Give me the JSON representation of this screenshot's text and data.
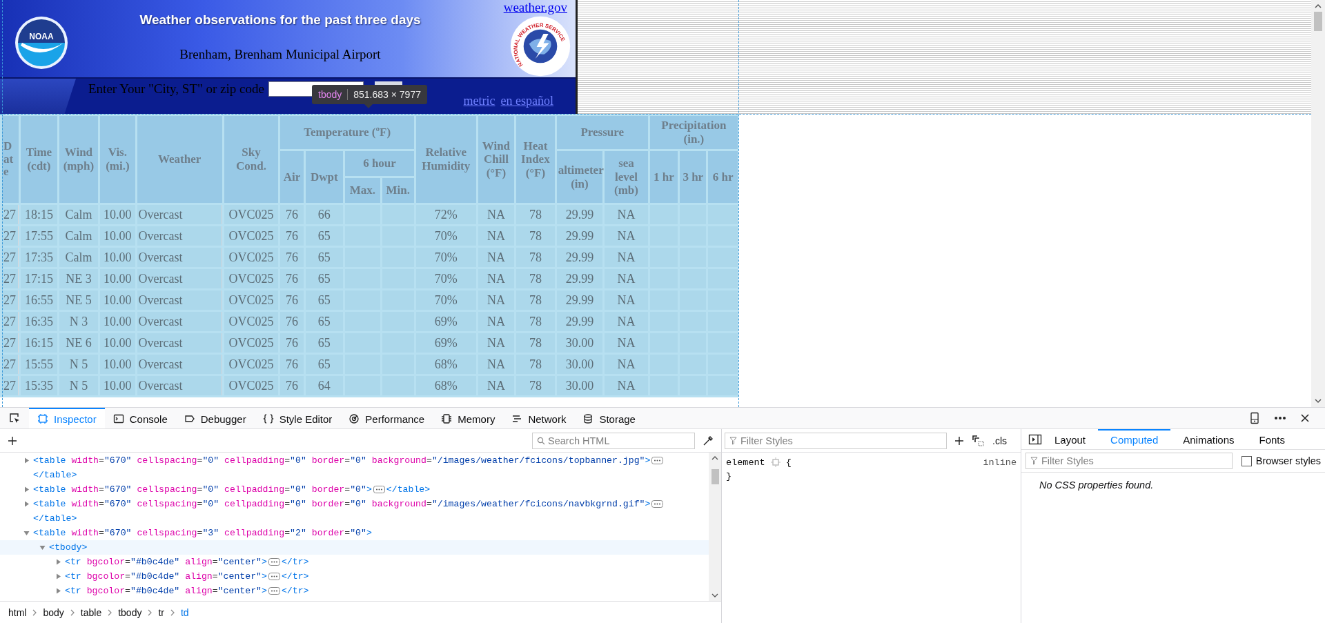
{
  "banner": {
    "title": "Weather observations for the past three days",
    "location": "Brenham, Brenham Municipal Airport",
    "home_link": "weather.gov",
    "noaa_logo_text": "NOAA",
    "nws_logo_text": "NATIONAL WEATHER SERVICE",
    "search_label": "Enter Your \"City, ST\" or zip code",
    "links": [
      "metric",
      "en español"
    ]
  },
  "tooltip": {
    "tag": "tbody",
    "size": "851.683 × 7977"
  },
  "table": {
    "columns": [
      {
        "label": "Date"
      },
      {
        "label": "Time (cdt)"
      },
      {
        "label": "Wind (mph)"
      },
      {
        "label": "Vis. (mi.)"
      },
      {
        "label": "Weather"
      },
      {
        "label": "Sky Cond."
      },
      {
        "label": "Temperature (ºF)",
        "children": [
          {
            "label": "Air"
          },
          {
            "label": "Dwpt"
          },
          {
            "label": "6 hour",
            "children": [
              {
                "label": "Max."
              },
              {
                "label": "Min."
              }
            ]
          }
        ]
      },
      {
        "label": "Relative Humidity"
      },
      {
        "label": "Wind Chill (°F)"
      },
      {
        "label": "Heat Index (°F)"
      },
      {
        "label": "Pressure",
        "children": [
          {
            "label": "altimeter (in)"
          },
          {
            "label": "sea level (mb)"
          }
        ]
      },
      {
        "label": "Precipitation (in.)",
        "children": [
          {
            "label": "1 hr"
          },
          {
            "label": "3 hr"
          },
          {
            "label": "6 hr"
          }
        ]
      }
    ],
    "rows": [
      {
        "date": "27",
        "time": "18:15",
        "wind": "Calm",
        "vis": "10.00",
        "weather": "Overcast",
        "sky": "OVC025",
        "air": "76",
        "dwpt": "66",
        "rh": "72%",
        "wind_chill": "NA",
        "heat_index": "78",
        "altimeter": "29.99",
        "sea_level": "NA"
      },
      {
        "date": "27",
        "time": "17:55",
        "wind": "Calm",
        "vis": "10.00",
        "weather": "Overcast",
        "sky": "OVC025",
        "air": "76",
        "dwpt": "65",
        "rh": "70%",
        "wind_chill": "NA",
        "heat_index": "78",
        "altimeter": "29.99",
        "sea_level": "NA"
      },
      {
        "date": "27",
        "time": "17:35",
        "wind": "Calm",
        "vis": "10.00",
        "weather": "Overcast",
        "sky": "OVC025",
        "air": "76",
        "dwpt": "65",
        "rh": "70%",
        "wind_chill": "NA",
        "heat_index": "78",
        "altimeter": "29.99",
        "sea_level": "NA"
      },
      {
        "date": "27",
        "time": "17:15",
        "wind": "NE 3",
        "vis": "10.00",
        "weather": "Overcast",
        "sky": "OVC025",
        "air": "76",
        "dwpt": "65",
        "rh": "70%",
        "wind_chill": "NA",
        "heat_index": "78",
        "altimeter": "29.99",
        "sea_level": "NA"
      },
      {
        "date": "27",
        "time": "16:55",
        "wind": "NE 5",
        "vis": "10.00",
        "weather": "Overcast",
        "sky": "OVC025",
        "air": "76",
        "dwpt": "65",
        "rh": "70%",
        "wind_chill": "NA",
        "heat_index": "78",
        "altimeter": "29.99",
        "sea_level": "NA"
      },
      {
        "date": "27",
        "time": "16:35",
        "wind": "N 3",
        "vis": "10.00",
        "weather": "Overcast",
        "sky": "OVC025",
        "air": "76",
        "dwpt": "65",
        "rh": "69%",
        "wind_chill": "NA",
        "heat_index": "78",
        "altimeter": "29.99",
        "sea_level": "NA"
      },
      {
        "date": "27",
        "time": "16:15",
        "wind": "NE 6",
        "vis": "10.00",
        "weather": "Overcast",
        "sky": "OVC025",
        "air": "76",
        "dwpt": "65",
        "rh": "69%",
        "wind_chill": "NA",
        "heat_index": "78",
        "altimeter": "30.00",
        "sea_level": "NA"
      },
      {
        "date": "27",
        "time": "15:55",
        "wind": "N 5",
        "vis": "10.00",
        "weather": "Overcast",
        "sky": "OVC025",
        "air": "76",
        "dwpt": "65",
        "rh": "68%",
        "wind_chill": "NA",
        "heat_index": "78",
        "altimeter": "30.00",
        "sea_level": "NA"
      },
      {
        "date": "27",
        "time": "15:35",
        "wind": "N 5",
        "vis": "10.00",
        "weather": "Overcast",
        "sky": "OVC025",
        "air": "76",
        "dwpt": "64",
        "rh": "68%",
        "wind_chill": "NA",
        "heat_index": "78",
        "altimeter": "30.00",
        "sea_level": "NA"
      }
    ]
  },
  "devtools": {
    "tabs": [
      {
        "label": "Inspector",
        "selected": true
      },
      {
        "label": "Console",
        "selected": false
      },
      {
        "label": "Debugger",
        "selected": false
      },
      {
        "label": "Style Editor",
        "selected": false
      },
      {
        "label": "Performance",
        "selected": false
      },
      {
        "label": "Memory",
        "selected": false
      },
      {
        "label": "Network",
        "selected": false
      },
      {
        "label": "Storage",
        "selected": false
      }
    ],
    "search": {
      "placeholder": "Search HTML"
    },
    "markup": [
      {
        "text": "<table width=\"670\" cellspacing=\"0\" cellpadding=\"0\" border=\"0\" background=\"/images/weather/fcicons/topbanner.jpg\">",
        "close": "</table>",
        "expanded": false,
        "selected": false
      },
      {
        "text": "<table width=\"670\" cellspacing=\"0\" cellpadding=\"0\" border=\"0\">",
        "close": "</table>",
        "expanded": false,
        "selected": false
      },
      {
        "text": "<table width=\"670\" cellspacing=\"0\" cellpadding=\"0\" border=\"0\" background=\"/images/weather/fcicons/navbkgrnd.gif\">",
        "close": "</table>",
        "expanded": false,
        "selected": false
      },
      {
        "text": "<table width=\"670\" cellspacing=\"3\" cellpadding=\"2\" border=\"0\">",
        "expanded": true,
        "selected": false,
        "children": [
          {
            "text": "<tbody>",
            "expanded": true,
            "selected": true,
            "children": [
              {
                "text": "<tr bgcolor=\"#b0c4de\" align=\"center\">",
                "close": "</tr>",
                "expanded": false,
                "selected": false
              },
              {
                "text": "<tr bgcolor=\"#b0c4de\" align=\"center\">",
                "close": "</tr>",
                "expanded": false,
                "selected": false
              },
              {
                "text": "<tr bgcolor=\"#b0c4de\" align=\"center\">",
                "close": "</tr>",
                "expanded": false,
                "selected": false
              }
            ]
          }
        ]
      }
    ],
    "breadcrumbs": [
      {
        "label": "html",
        "selected": false
      },
      {
        "label": "body",
        "selected": false
      },
      {
        "label": "table",
        "selected": false
      },
      {
        "label": "tbody",
        "selected": false
      },
      {
        "label": "tr",
        "selected": false
      },
      {
        "label": "td",
        "selected": true
      }
    ],
    "rules": {
      "filter_placeholder": "Filter Styles",
      "class_button": ".cls",
      "selector": "element",
      "open_brace": "{",
      "close_brace": "}",
      "source": "inline"
    },
    "sidebar": {
      "tabs": [
        {
          "label": "Layout",
          "selected": false
        },
        {
          "label": "Computed",
          "selected": true
        },
        {
          "label": "Animations",
          "selected": false
        },
        {
          "label": "Fonts",
          "selected": false
        }
      ],
      "filter_placeholder": "Filter Styles",
      "browser_styles": {
        "label": "Browser styles",
        "checked": false
      },
      "message": "No CSS properties found."
    }
  }
}
